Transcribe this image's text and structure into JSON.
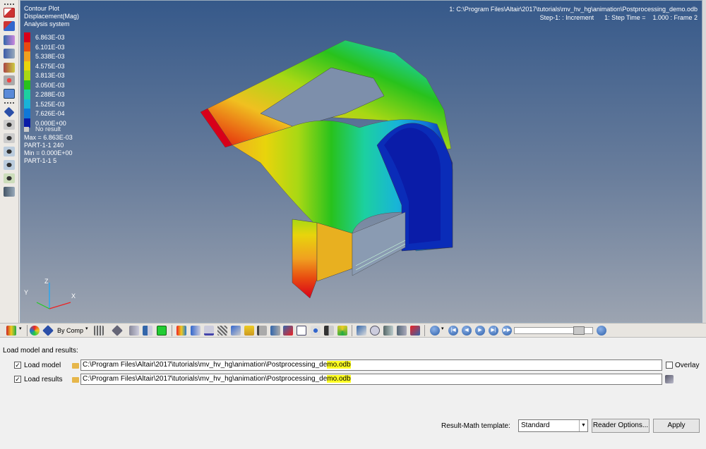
{
  "viewport": {
    "plot_type": "Contour Plot",
    "result_type": "Displacement(Mag)",
    "system": "Analysis system",
    "legend": [
      {
        "value": "6.863E-03",
        "color": "#d8001a"
      },
      {
        "value": "6.101E-03",
        "color": "#e84a10"
      },
      {
        "value": "5.338E-03",
        "color": "#f0a020"
      },
      {
        "value": "4.575E-03",
        "color": "#e8d40c"
      },
      {
        "value": "3.813E-03",
        "color": "#a8d814"
      },
      {
        "value": "3.050E-03",
        "color": "#28c21c"
      },
      {
        "value": "2.288E-03",
        "color": "#1cd0a0"
      },
      {
        "value": "1.525E-03",
        "color": "#18b4d8"
      },
      {
        "value": "7.626E-04",
        "color": "#1078d8"
      },
      {
        "value": "0.000E+00",
        "color": "#0a1ca8"
      }
    ],
    "no_result": "No result",
    "max_label": "Max = 6.863E-03",
    "max_part": "PART-1-1 240",
    "min_label": "Min = 0.000E+00",
    "min_part": "PART-1-1 5",
    "file_title": "1: C:\\Program Files\\Altair\\2017\\tutorials\\mv_hv_hg\\animation\\Postprocessing_demo.odb",
    "step_info": "Step-1: : Increment      1: Step Time =    1.000 : Frame 2",
    "triad": {
      "x": "X",
      "y": "Y",
      "z": "Z"
    }
  },
  "toolbar": {
    "comp_mode": "By Comp",
    "slider_position": 0.88
  },
  "panel": {
    "section_title": "Load model and results:",
    "load_model": {
      "label": "Load model",
      "checked": "✓",
      "path_prefix": "C:\\Program Files\\Altair\\2017\\tutorials\\mv_hv_hg\\animation\\Postprocessing_de",
      "path_highlight": "mo.odb"
    },
    "load_results": {
      "label": "Load results",
      "checked": "✓",
      "path_prefix": "C:\\Program Files\\Altair\\2017\\tutorials\\mv_hv_hg\\animation\\Postprocessing_de",
      "path_highlight": "mo.odb"
    },
    "overlay_label": "Overlay",
    "template_label": "Result-Math template:",
    "template_value": "Standard",
    "reader_options": "Reader Options...",
    "apply": "Apply"
  }
}
